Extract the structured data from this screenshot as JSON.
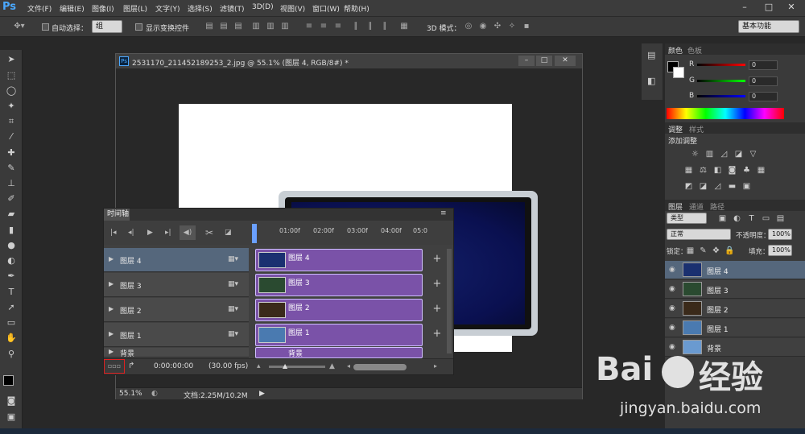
{
  "app": {
    "logo": "Ps"
  },
  "menu": [
    "文件(F)",
    "编辑(E)",
    "图像(I)",
    "图层(L)",
    "文字(Y)",
    "选择(S)",
    "滤镜(T)",
    "3D(D)",
    "视图(V)",
    "窗口(W)",
    "帮助(H)"
  ],
  "window_controls": {
    "minimize": "–",
    "maximize": "□",
    "close": "✕"
  },
  "options": {
    "auto_select_label": "自动选择：",
    "auto_select_value": "组",
    "show_transform_label": "显示变换控件",
    "mode_3d_label": "3D 模式：",
    "workspace": "基本功能"
  },
  "document": {
    "title": "2531170_211452189253_2.jpg @ 55.1% (图层 4, RGB/8#) *",
    "zoom": "55.1%",
    "doc_info": "文档:2.25M/10.2M"
  },
  "timeline": {
    "tab": "时间轴",
    "time_marks": [
      "01:00f",
      "02:00f",
      "03:00f",
      "04:00f",
      "05:0"
    ],
    "current_time": "0:00:00:00",
    "fps": "(30.00 fps)",
    "layers": [
      {
        "name": "图层 4",
        "clip": "图层 4",
        "active": true
      },
      {
        "name": "图层 3",
        "clip": "图层 3",
        "active": false
      },
      {
        "name": "图层 2",
        "clip": "图层 2",
        "active": false
      },
      {
        "name": "图层 1",
        "clip": "图层 1",
        "active": false
      }
    ],
    "bg_clip": "背景",
    "bg_layer_partial": "背景"
  },
  "color_panel": {
    "tabs": [
      "颜色",
      "色板"
    ],
    "r_label": "R",
    "g_label": "G",
    "b_label": "B",
    "r": "0",
    "g": "0",
    "b": "0"
  },
  "adjust_panel": {
    "tabs": [
      "调整",
      "样式"
    ],
    "title": "添加调整"
  },
  "layers_panel": {
    "tabs": [
      "图层",
      "通道",
      "路径"
    ],
    "filter_type": "类型",
    "blend_mode": "正常",
    "opacity_label": "不透明度：",
    "opacity": "100%",
    "lock_label": "锁定：",
    "fill_label": "填充：",
    "fill": "100%",
    "layers": [
      {
        "name": "图层 4",
        "active": true
      },
      {
        "name": "图层 3",
        "active": false
      },
      {
        "name": "图层 2",
        "active": false
      },
      {
        "name": "图层 1",
        "active": false
      },
      {
        "name": "背景",
        "active": false
      }
    ]
  },
  "watermark": {
    "brand": "Bai",
    "brand2": "经验",
    "url": "jingyan.baidu.com"
  },
  "colors": {
    "accent": "#4aa8ff",
    "clip": "#7a52a8",
    "active_row": "#55677c"
  }
}
